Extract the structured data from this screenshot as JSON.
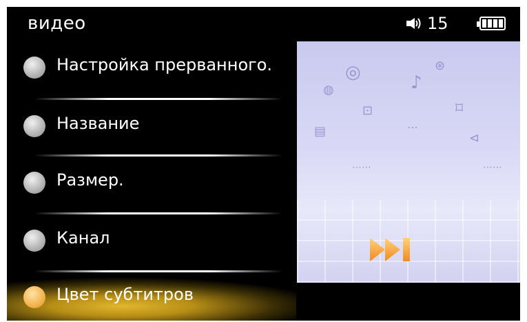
{
  "topbar": {
    "title": "видео",
    "volume_level": "15",
    "battery_icon": "battery-icon",
    "volume_icon": "speaker-icon"
  },
  "menu": {
    "items": [
      {
        "label": "Настройка прерванного.",
        "selected": false
      },
      {
        "label": "Название",
        "selected": false
      },
      {
        "label": "Размер.",
        "selected": false
      },
      {
        "label": "Канал",
        "selected": false
      },
      {
        "label": "Цвет субтитров",
        "selected": true
      }
    ]
  },
  "preview": {
    "button_icon": "fast-forward-icon",
    "accent": "#f7b04a"
  },
  "colors": {
    "background": "#000000",
    "text": "#ffffff",
    "selection": "#e2b62e"
  }
}
